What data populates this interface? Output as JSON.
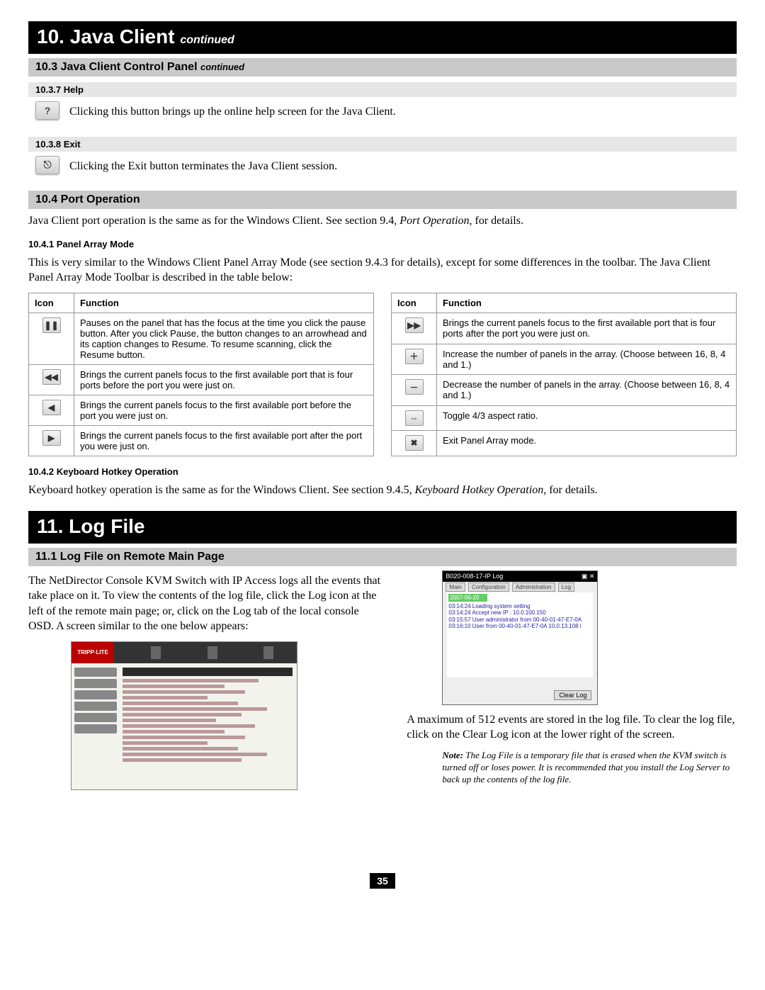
{
  "chapter10": {
    "title": "10. Java Client",
    "cont": "continued"
  },
  "section103": {
    "title": "10.3 Java Client Control Panel",
    "cont": "continued"
  },
  "s1037": {
    "title": "10.3.7 Help",
    "text": "Clicking this button brings up the online help screen for the Java Client.",
    "icon": "?"
  },
  "s1038": {
    "title": "10.3.8 Exit",
    "text": "Clicking the Exit button terminates the Java Client session.",
    "icon": "⎋"
  },
  "section104": {
    "title": "10.4 Port Operation",
    "text_a": "Java Client port operation is the same as for the Windows Client. See section 9.4, ",
    "text_em": "Port Operation",
    "text_b": ", for details."
  },
  "s1041": {
    "title": "10.4.1 Panel Array Mode",
    "text": "This is very similar to the Windows Client Panel Array Mode (see section 9.4.3 for details), except for some differences in the toolbar. The Java Client Panel Array Mode Toolbar is described in the table below:"
  },
  "table": {
    "h_icon": "Icon",
    "h_func": "Function",
    "left": [
      {
        "glyph": "❚❚",
        "func": "Pauses on the panel that has the focus at the time you click the pause button. After you click Pause, the button changes to an arrowhead and its caption changes to Resume. To resume scanning, click the Resume button."
      },
      {
        "glyph": "◀◀",
        "func": "Brings the current panels focus to the first available port that is four ports before the port you were just on."
      },
      {
        "glyph": "◀",
        "func": "Brings the current panels focus to the first available port before the port you were just on."
      },
      {
        "glyph": "▶",
        "func": "Brings the current panels focus to the first available port after the port you were just on."
      }
    ],
    "right": [
      {
        "glyph": "▶▶",
        "func": "Brings the current panels focus to the first available port that is four ports after the port you were just on."
      },
      {
        "glyph": "＋",
        "func": "Increase the number of panels in the array. (Choose between 16, 8, 4 and 1.)"
      },
      {
        "glyph": "－",
        "func": "Decrease the number of panels in the array. (Choose between 16, 8, 4 and 1.)"
      },
      {
        "glyph": "⇔",
        "func": "Toggle 4/3 aspect ratio."
      },
      {
        "glyph": "✖",
        "func": "Exit Panel Array mode."
      }
    ]
  },
  "s1042": {
    "title": "10.4.2 Keyboard Hotkey Operation",
    "text_a": "Keyboard hotkey operation is the same as for the Windows Client. See section 9.4.5, ",
    "text_em": "Keyboard Hotkey Operation",
    "text_b": ", for details."
  },
  "chapter11": {
    "title": "11. Log File"
  },
  "section111": {
    "title": "11.1 Log File on Remote Main Page",
    "para1": "The NetDirector Console KVM Switch with IP Access logs all the events that take place on it. To view the contents of the log file, click the Log icon at the left of the remote main page; or, click on the Log tab of the local console OSD. A screen similar to the one below appears:",
    "para2": "A maximum of 512 events are stored in the log file. To clear the log file, click on the Clear Log icon at the lower right of the screen.",
    "note_label": "Note:",
    "note": " The Log File is a temporary file that is erased when the KVM switch is turned off or loses power. It is recommended that you install the Log Server to back up the contents of the log file."
  },
  "shot_large": {
    "brand": "TRIPP·LITE"
  },
  "shot_small": {
    "title": "B020-008-17-IP Log",
    "tabs": [
      "Main",
      "Configuration",
      "Administration",
      "Log"
    ],
    "date": "2007-06-20",
    "lines": [
      "03:14:24 Loading system setting",
      "03:14:24 Accept new IP : 10.0.100.150",
      "03:15:57 User administrator from 00-40-01-47-E7-0A",
      "03:16:10 User from 00-40-01-47-E7-0A 10.0.13.108 l"
    ],
    "clear": "Clear Log"
  },
  "page_number": "35"
}
